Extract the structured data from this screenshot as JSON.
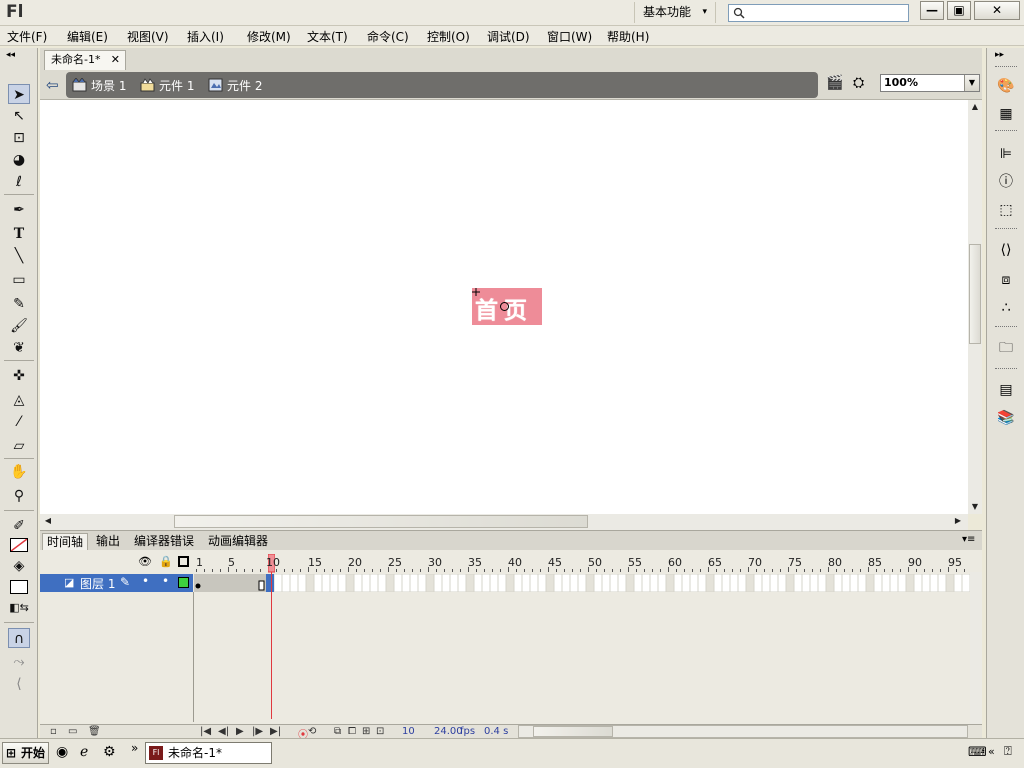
{
  "app": {
    "logo": "Fl",
    "workspace": "基本功能",
    "search_placeholder": ""
  },
  "menu": [
    "文件(F)",
    "编辑(E)",
    "视图(V)",
    "插入(I)",
    "修改(M)",
    "文本(T)",
    "命令(C)",
    "控制(O)",
    "调试(D)",
    "窗口(W)",
    "帮助(H)"
  ],
  "document": {
    "tab_title": "未命名-1*"
  },
  "breadcrumb": [
    "场景 1",
    "元件 1",
    "元件 2"
  ],
  "zoom": "100%",
  "stage": {
    "symbol_text": "首页"
  },
  "panel_tabs": [
    "时间轴",
    "输出",
    "编译器错误",
    "动画编辑器"
  ],
  "timeline": {
    "ruler": [
      "1",
      "5",
      "10",
      "15",
      "20",
      "25",
      "30",
      "35",
      "40",
      "45",
      "50",
      "55",
      "60",
      "65",
      "70",
      "75",
      "80",
      "85",
      "90",
      "95"
    ],
    "current_frame": 10,
    "layer_name": "图层 1",
    "status_frame": "10",
    "status_fps": "24.00",
    "fps_unit": "fps",
    "status_time": "0.4 s"
  },
  "taskbar": {
    "start": "开始",
    "task": "未命名-1*"
  },
  "colors": {
    "stage_symbol_fill": "#ee8c98",
    "layer_selected": "#3f6fc1",
    "playhead": "#e0393f",
    "fill_color": "#ffffff",
    "keyframe_fill": "#3ecf3e"
  }
}
